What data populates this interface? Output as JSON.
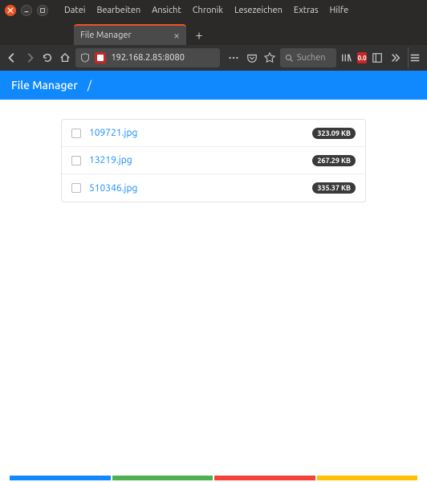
{
  "window": {
    "menus": [
      "Datei",
      "Bearbeiten",
      "Ansicht",
      "Chronik",
      "Lesezeichen",
      "Extras",
      "Hilfe"
    ]
  },
  "tab": {
    "title": "File Manager"
  },
  "nav": {
    "url": "192.168.2.85:8080",
    "search_placeholder": "Suchen",
    "ext_badge": "0.0"
  },
  "page": {
    "title": "File Manager",
    "path": "/"
  },
  "files": [
    {
      "name": "109721.jpg",
      "size": "323.09 KB"
    },
    {
      "name": "13219.jpg",
      "size": "267.29 KB"
    },
    {
      "name": "510346.jpg",
      "size": "335.37 KB"
    }
  ]
}
